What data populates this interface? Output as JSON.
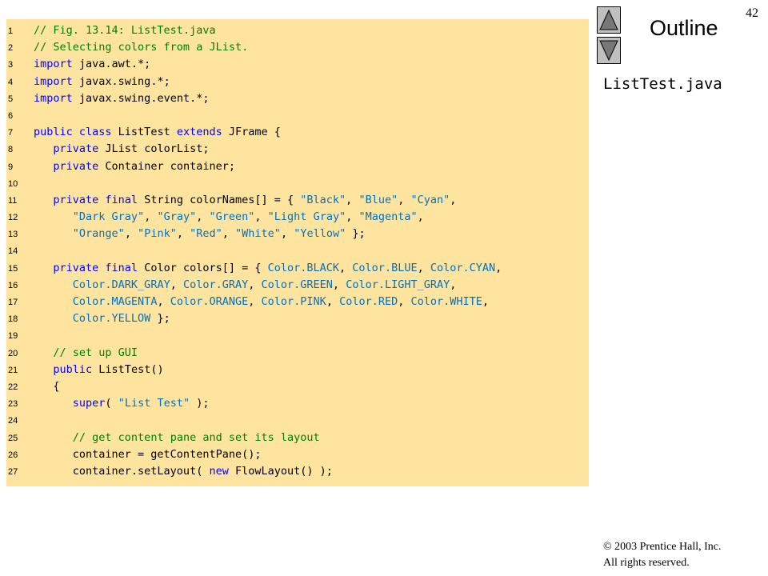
{
  "slide": {
    "page_number": "42",
    "outline_title": "Outline",
    "file_label": "ListTest.java",
    "copyright_line1": "© 2003 Prentice Hall, Inc.",
    "copyright_line2": "All rights reserved.",
    "nav_up_icon": "up-arrow-icon",
    "nav_down_icon": "down-arrow-icon"
  },
  "code": {
    "lines": [
      {
        "num": "1",
        "tokens": [
          {
            "t": "comment",
            "s": "// Fig. 13.14: ListTest.java"
          }
        ]
      },
      {
        "num": "2",
        "tokens": [
          {
            "t": "comment",
            "s": "// Selecting colors from a JList."
          }
        ]
      },
      {
        "num": "3",
        "tokens": [
          {
            "t": "keyword",
            "s": "import"
          },
          {
            "t": "plain",
            "s": " java.awt.*;"
          }
        ]
      },
      {
        "num": "4",
        "tokens": [
          {
            "t": "keyword",
            "s": "import"
          },
          {
            "t": "plain",
            "s": " javax.swing.*;"
          }
        ]
      },
      {
        "num": "5",
        "tokens": [
          {
            "t": "keyword",
            "s": "import"
          },
          {
            "t": "plain",
            "s": " javax.swing.event.*;"
          }
        ]
      },
      {
        "num": "6",
        "tokens": []
      },
      {
        "num": "7",
        "tokens": [
          {
            "t": "keyword",
            "s": "public class"
          },
          {
            "t": "plain",
            "s": " ListTest "
          },
          {
            "t": "keyword",
            "s": "extends"
          },
          {
            "t": "plain",
            "s": " JFrame {"
          }
        ]
      },
      {
        "num": "8",
        "tokens": [
          {
            "t": "plain",
            "s": "   "
          },
          {
            "t": "keyword",
            "s": "private"
          },
          {
            "t": "plain",
            "s": " JList colorList;"
          }
        ]
      },
      {
        "num": "9",
        "tokens": [
          {
            "t": "plain",
            "s": "   "
          },
          {
            "t": "keyword",
            "s": "private"
          },
          {
            "t": "plain",
            "s": " Container container;"
          }
        ]
      },
      {
        "num": "10",
        "tokens": []
      },
      {
        "num": "11",
        "tokens": [
          {
            "t": "plain",
            "s": "   "
          },
          {
            "t": "keyword",
            "s": "private final"
          },
          {
            "t": "plain",
            "s": " String colorNames[] = { "
          },
          {
            "t": "string",
            "s": "\"Black\""
          },
          {
            "t": "plain",
            "s": ", "
          },
          {
            "t": "string",
            "s": "\"Blue\""
          },
          {
            "t": "plain",
            "s": ", "
          },
          {
            "t": "string",
            "s": "\"Cyan\""
          },
          {
            "t": "plain",
            "s": ","
          }
        ]
      },
      {
        "num": "12",
        "tokens": [
          {
            "t": "plain",
            "s": "      "
          },
          {
            "t": "string",
            "s": "\"Dark Gray\""
          },
          {
            "t": "plain",
            "s": ", "
          },
          {
            "t": "string",
            "s": "\"Gray\""
          },
          {
            "t": "plain",
            "s": ", "
          },
          {
            "t": "string",
            "s": "\"Green\""
          },
          {
            "t": "plain",
            "s": ", "
          },
          {
            "t": "string",
            "s": "\"Light Gray\""
          },
          {
            "t": "plain",
            "s": ", "
          },
          {
            "t": "string",
            "s": "\"Magenta\""
          },
          {
            "t": "plain",
            "s": ","
          }
        ]
      },
      {
        "num": "13",
        "tokens": [
          {
            "t": "plain",
            "s": "      "
          },
          {
            "t": "string",
            "s": "\"Orange\""
          },
          {
            "t": "plain",
            "s": ", "
          },
          {
            "t": "string",
            "s": "\"Pink\""
          },
          {
            "t": "plain",
            "s": ", "
          },
          {
            "t": "string",
            "s": "\"Red\""
          },
          {
            "t": "plain",
            "s": ", "
          },
          {
            "t": "string",
            "s": "\"White\""
          },
          {
            "t": "plain",
            "s": ", "
          },
          {
            "t": "string",
            "s": "\"Yellow\""
          },
          {
            "t": "plain",
            "s": " };"
          }
        ]
      },
      {
        "num": "14",
        "tokens": []
      },
      {
        "num": "15",
        "tokens": [
          {
            "t": "plain",
            "s": "   "
          },
          {
            "t": "keyword",
            "s": "private final"
          },
          {
            "t": "plain",
            "s": " Color colors[] = { "
          },
          {
            "t": "constant",
            "s": "Color.BLACK"
          },
          {
            "t": "plain",
            "s": ", "
          },
          {
            "t": "constant",
            "s": "Color.BLUE"
          },
          {
            "t": "plain",
            "s": ", "
          },
          {
            "t": "constant",
            "s": "Color.CYAN"
          },
          {
            "t": "plain",
            "s": ","
          }
        ]
      },
      {
        "num": "16",
        "tokens": [
          {
            "t": "plain",
            "s": "      "
          },
          {
            "t": "constant",
            "s": "Color.DARK_GRAY"
          },
          {
            "t": "plain",
            "s": ", "
          },
          {
            "t": "constant",
            "s": "Color.GRAY"
          },
          {
            "t": "plain",
            "s": ", "
          },
          {
            "t": "constant",
            "s": "Color.GREEN"
          },
          {
            "t": "plain",
            "s": ", "
          },
          {
            "t": "constant",
            "s": "Color.LIGHT_GRAY"
          },
          {
            "t": "plain",
            "s": ","
          }
        ]
      },
      {
        "num": "17",
        "tokens": [
          {
            "t": "plain",
            "s": "      "
          },
          {
            "t": "constant",
            "s": "Color.MAGENTA"
          },
          {
            "t": "plain",
            "s": ", "
          },
          {
            "t": "constant",
            "s": "Color.ORANGE"
          },
          {
            "t": "plain",
            "s": ", "
          },
          {
            "t": "constant",
            "s": "Color.PINK"
          },
          {
            "t": "plain",
            "s": ", "
          },
          {
            "t": "constant",
            "s": "Color.RED"
          },
          {
            "t": "plain",
            "s": ", "
          },
          {
            "t": "constant",
            "s": "Color.WHITE"
          },
          {
            "t": "plain",
            "s": ","
          }
        ]
      },
      {
        "num": "18",
        "tokens": [
          {
            "t": "plain",
            "s": "      "
          },
          {
            "t": "constant",
            "s": "Color.YELLOW"
          },
          {
            "t": "plain",
            "s": " };"
          }
        ]
      },
      {
        "num": "19",
        "tokens": []
      },
      {
        "num": "20",
        "tokens": [
          {
            "t": "plain",
            "s": "   "
          },
          {
            "t": "comment",
            "s": "// set up GUI"
          }
        ]
      },
      {
        "num": "21",
        "tokens": [
          {
            "t": "plain",
            "s": "   "
          },
          {
            "t": "keyword",
            "s": "public"
          },
          {
            "t": "plain",
            "s": " ListTest()"
          }
        ]
      },
      {
        "num": "22",
        "tokens": [
          {
            "t": "plain",
            "s": "   {"
          }
        ]
      },
      {
        "num": "23",
        "tokens": [
          {
            "t": "plain",
            "s": "      "
          },
          {
            "t": "keyword",
            "s": "super"
          },
          {
            "t": "plain",
            "s": "( "
          },
          {
            "t": "string",
            "s": "\"List Test\""
          },
          {
            "t": "plain",
            "s": " );"
          }
        ]
      },
      {
        "num": "24",
        "tokens": []
      },
      {
        "num": "25",
        "tokens": [
          {
            "t": "plain",
            "s": "      "
          },
          {
            "t": "comment",
            "s": "// get content pane and set its layout"
          }
        ]
      },
      {
        "num": "26",
        "tokens": [
          {
            "t": "plain",
            "s": "      container = getContentPane();"
          }
        ]
      },
      {
        "num": "27",
        "tokens": [
          {
            "t": "plain",
            "s": "      container.setLayout( "
          },
          {
            "t": "keyword",
            "s": "new"
          },
          {
            "t": "plain",
            "s": " FlowLayout() );"
          }
        ]
      }
    ]
  },
  "colors": {
    "code_background": "#ffe4a0",
    "comment": "#008000",
    "keyword": "#0000ff",
    "string": "#0070c0",
    "nav_button": "#c0c0c0"
  }
}
